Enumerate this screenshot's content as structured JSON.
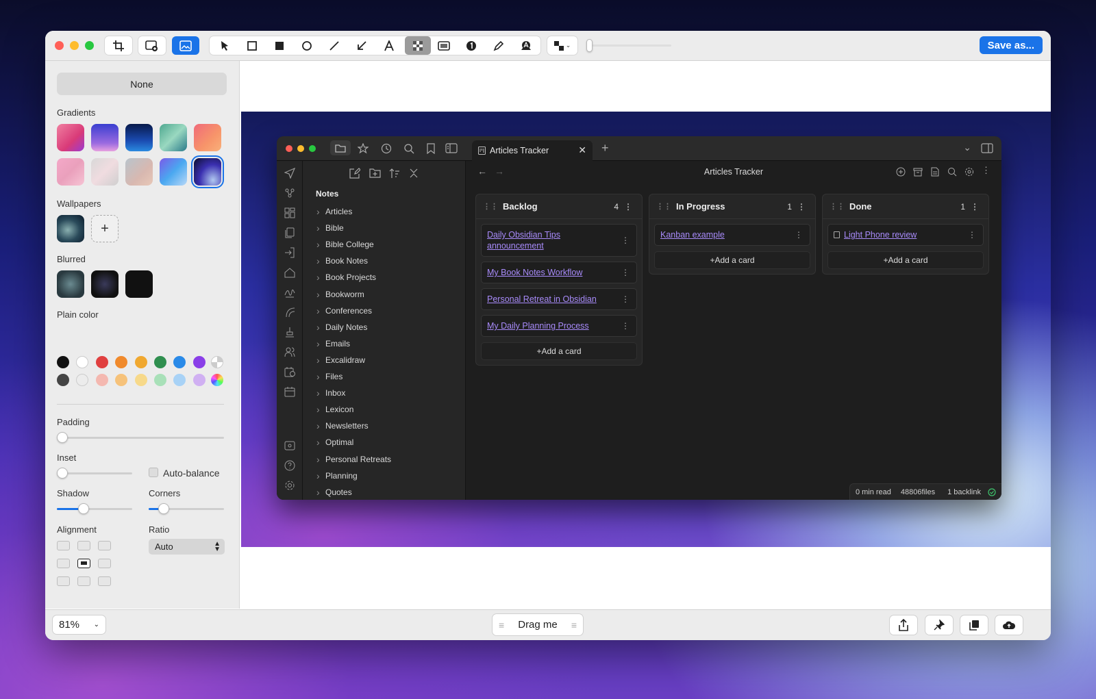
{
  "app": {
    "save_label": "Save as...",
    "zoom": "81%",
    "drag_label": "Drag me"
  },
  "sidebar": {
    "none_label": "None",
    "gradients_label": "Gradients",
    "wallpapers_label": "Wallpapers",
    "blurred_label": "Blurred",
    "plain_color_label": "Plain color",
    "padding_label": "Padding",
    "inset_label": "Inset",
    "auto_balance_label": "Auto-balance",
    "shadow_label": "Shadow",
    "corners_label": "Corners",
    "alignment_label": "Alignment",
    "ratio_label": "Ratio",
    "ratio_value": "Auto",
    "padding_value": 0,
    "inset_value": 0,
    "shadow_value": 0.35,
    "corners_value": 0.2,
    "plain_colors_row1": [
      "#111111",
      "#ffffff",
      "#e04040",
      "#f08a2c",
      "#f0a830",
      "#2f8f4f",
      "#2a8ae8",
      "#8a3fe8"
    ],
    "plain_colors_row2": [
      "#444444",
      "#ececec",
      "#f4b8b0",
      "#f6c27a",
      "#f7d98a",
      "#a8e0b8",
      "#a8d2f6",
      "#d0b0f2"
    ]
  },
  "obsidian": {
    "tab_title": "Articles Tracker",
    "header_title": "Articles Tracker",
    "notes_root": "Notes",
    "folders": [
      "Articles",
      "Bible",
      "Bible College",
      "Book Notes",
      "Book Projects",
      "Bookworm",
      "Conferences",
      "Daily Notes",
      "Emails",
      "Excalidraw",
      "Files",
      "Inbox",
      "Lexicon",
      "Newsletters",
      "Optimal",
      "Personal Retreats",
      "Planning",
      "Quotes"
    ],
    "lanes": [
      {
        "title": "Backlog",
        "count": "4",
        "cards": [
          "Daily Obsidian Tips announcement",
          "My Book Notes Workflow",
          "Personal Retreat in Obsidian",
          "My Daily Planning Process"
        ],
        "add": "+Add a card"
      },
      {
        "title": "In Progress",
        "count": "1",
        "cards": [
          "Kanban example"
        ],
        "add": "+Add a card"
      },
      {
        "title": "Done",
        "count": "1",
        "cards": [
          "Light Phone review"
        ],
        "add": "+Add a card"
      }
    ],
    "status": {
      "read": "0 min read",
      "files": "48806files",
      "backlinks": "1 backlink"
    }
  }
}
